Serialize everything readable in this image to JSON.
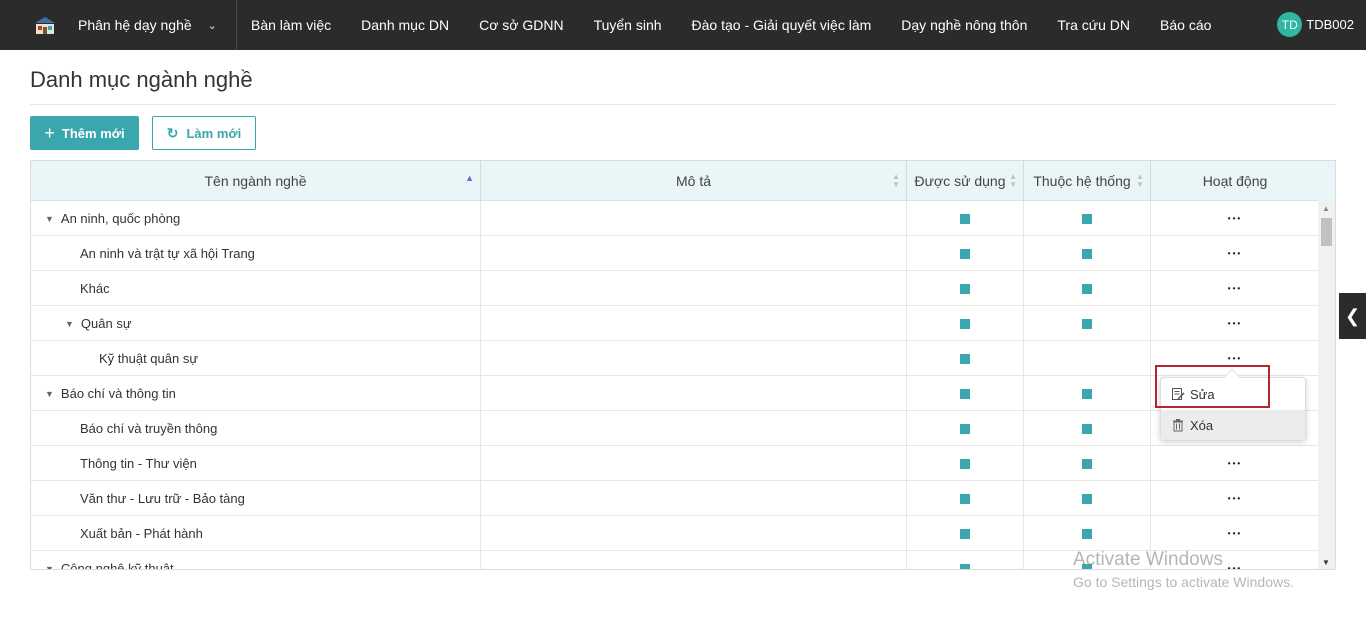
{
  "topbar": {
    "module_label": "Phân hệ dạy nghề",
    "nav": [
      "Bàn làm việc",
      "Danh mục DN",
      "Cơ sở GDNN",
      "Tuyển sinh",
      "Đào tạo - Giải quyết việc làm",
      "Dạy nghề nông thôn",
      "Tra cứu DN",
      "Báo cáo"
    ],
    "avatar_initials": "TD",
    "username": "TDB002"
  },
  "page": {
    "title": "Danh mục ngành nghề",
    "add_button": "Thêm mới",
    "refresh_button": "Làm mới"
  },
  "table": {
    "columns": [
      "Tên ngành nghề",
      "Mô tả",
      "Được sử dụng",
      "Thuộc hệ thống",
      "Hoạt động"
    ],
    "rows": [
      {
        "name": "An ninh, quốc phòng",
        "level": 0,
        "expand": true,
        "used": true,
        "system": true,
        "dots": true
      },
      {
        "name": "An ninh và trật tự xã hội Trang",
        "level": 1,
        "expand": false,
        "used": true,
        "system": true,
        "dots": true
      },
      {
        "name": "Khác",
        "level": 1,
        "expand": false,
        "used": true,
        "system": true,
        "dots": true
      },
      {
        "name": "Quân sự",
        "level": 1,
        "expand": true,
        "used": true,
        "system": true,
        "dots": true
      },
      {
        "name": "Kỹ thuật quân sự",
        "level": 2,
        "expand": false,
        "used": true,
        "system": false,
        "dots": true
      },
      {
        "name": "Báo chí và thông tin",
        "level": 0,
        "expand": true,
        "used": true,
        "system": true,
        "dots": false
      },
      {
        "name": "Báo chí và truyền thông",
        "level": 1,
        "expand": false,
        "used": true,
        "system": true,
        "dots": false
      },
      {
        "name": "Thông tin - Thư viện",
        "level": 1,
        "expand": false,
        "used": true,
        "system": true,
        "dots": true
      },
      {
        "name": "Văn thư - Lưu trữ - Bảo tàng",
        "level": 1,
        "expand": false,
        "used": true,
        "system": true,
        "dots": true
      },
      {
        "name": "Xuất bản - Phát hành",
        "level": 1,
        "expand": false,
        "used": true,
        "system": true,
        "dots": true
      },
      {
        "name": "Công nghệ kỹ thuật",
        "level": 0,
        "expand": true,
        "used": true,
        "system": true,
        "dots": true
      }
    ]
  },
  "action_menu": {
    "edit": "Sửa",
    "delete": "Xóa"
  },
  "watermark": {
    "line1": "Activate Windows",
    "line2": "Go to Settings to activate Windows."
  },
  "colors": {
    "topbar": "#2b2b2b",
    "accent": "#3aa6ad",
    "avatar": "#2fb7a2",
    "header_bg": "#e9f5f6",
    "highlight": "#b3262e"
  }
}
